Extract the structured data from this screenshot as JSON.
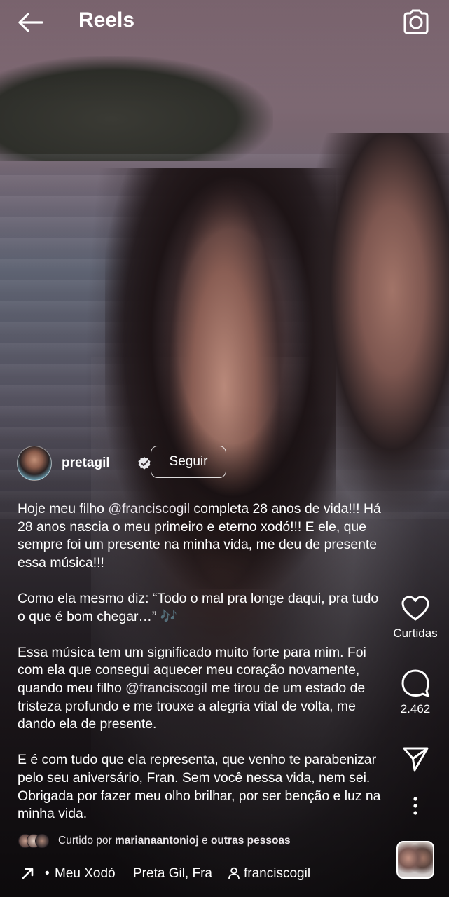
{
  "header": {
    "title": "Reels",
    "back_icon": "arrow-left-icon",
    "camera_icon": "camera-icon"
  },
  "author": {
    "username": "pretagil",
    "verified_icon": "verified-badge-icon",
    "follow_label": "Seguir"
  },
  "caption": {
    "paragraphs": [
      {
        "before": "Hoje meu filho ",
        "mention": "@franciscogil",
        "after": " completa 28 anos de vida!!! Há 28 anos nascia o meu primeiro e eterno xodó!!! E ele, que sempre foi um presente na minha vida, me deu de presente essa música!!!"
      },
      {
        "text": "Como ela mesmo diz: “Todo o mal pra longe daqui, pra tudo o que é bom chegar…”",
        "emoji": "🎶"
      },
      {
        "before": "Essa música tem um significado muito forte para mim. Foi com ela que consegui aquecer meu coração novamente, quando meu filho ",
        "mention": "@franciscogil",
        "after": " me tirou de um estado de tristeza profundo e me trouxe a alegria vital de volta, me dando ela de presente."
      },
      {
        "text": "E é com tudo que ela representa, que venho te parabenizar pelo seu aniversário, Fran. Sem você nessa vida, nem sei. Obrigada por fazer meu olho brilhar, por ser benção e luz na minha vida."
      }
    ]
  },
  "actions": {
    "like": {
      "icon": "heart-icon",
      "label": "Curtidas"
    },
    "comment": {
      "icon": "comment-bubble-icon",
      "count": "2.462"
    },
    "share": {
      "icon": "send-icon"
    },
    "more": {
      "icon": "more-vertical-icon"
    }
  },
  "liked_by": {
    "prefix": "Curtido por ",
    "user": "marianaantonioj",
    "middle": " e ",
    "others": "outras pessoas"
  },
  "audio": {
    "arrow_icon": "arrow-up-right-icon",
    "bullet": "•",
    "song": "Meu Xodó",
    "artist": "Preta Gil, Fra",
    "person_icon": "person-tag-icon",
    "tagged_user": "franciscogil",
    "thumb_icon": "audio-thumbnail"
  },
  "colors": {
    "text": "#ffffff",
    "music_emoji": "#b07ad8",
    "follow_border": "#ffffff"
  }
}
